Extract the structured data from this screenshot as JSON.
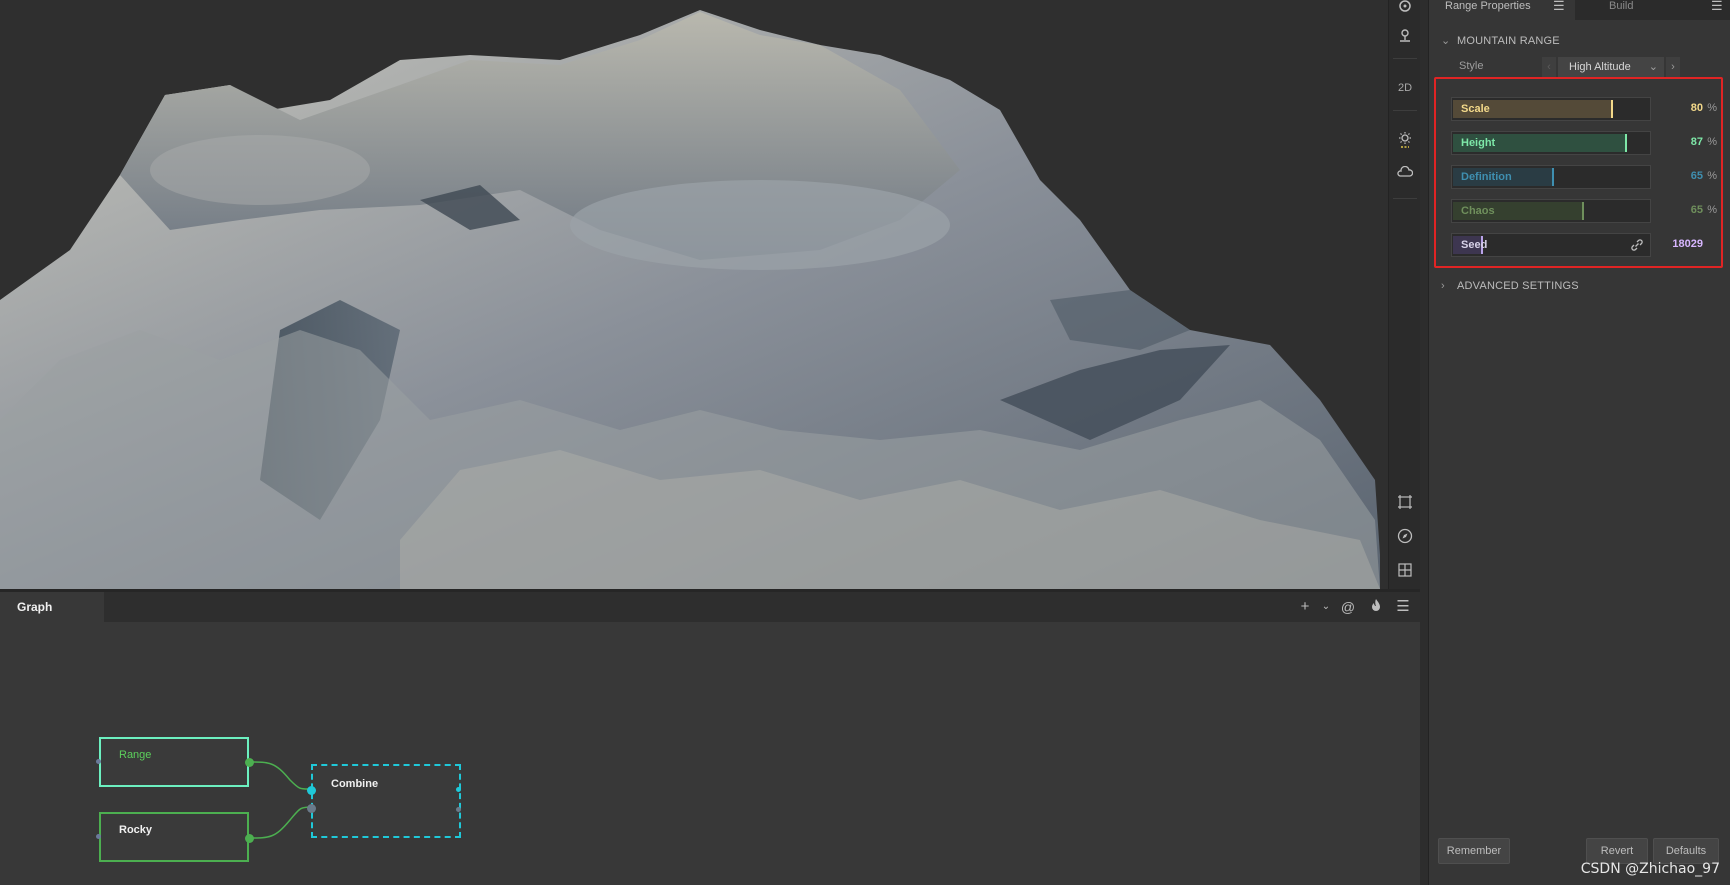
{
  "graph": {
    "tab_label": "Graph",
    "nodes": [
      {
        "label": "Range"
      },
      {
        "label": "Rocky"
      },
      {
        "label": "Combine"
      }
    ]
  },
  "toolbar": {
    "view_2d_label": "2D"
  },
  "panel": {
    "tabs": [
      {
        "label": "Range Properties"
      },
      {
        "label": "Build"
      }
    ],
    "section_title": "MOUNTAIN RANGE",
    "style": {
      "label": "Style",
      "value": "High Altitude"
    },
    "sliders": [
      {
        "label": "Scale",
        "value": "80",
        "unit": "%",
        "fraction": 0.8,
        "color": "#f3d98a",
        "fill": "#544a38"
      },
      {
        "label": "Height",
        "value": "87",
        "unit": "%",
        "fraction": 0.87,
        "color": "#7ee8a8",
        "fill": "#2f5040"
      },
      {
        "label": "Definition",
        "value": "65",
        "unit": "%",
        "fraction": 0.5,
        "color": "#3f8fb0",
        "fill": "#2a3c44"
      },
      {
        "label": "Chaos",
        "value": "65",
        "unit": "%",
        "fraction": 0.65,
        "color": "#6f8f5c",
        "fill": "#35402f"
      }
    ],
    "seed": {
      "label": "Seed",
      "value": "18029",
      "color": "#d7b6ff"
    },
    "advanced_title": "ADVANCED SETTINGS",
    "buttons": {
      "remember": "Remember",
      "revert": "Revert",
      "defaults": "Defaults"
    }
  },
  "watermark": "CSDN @Zhichao_97"
}
